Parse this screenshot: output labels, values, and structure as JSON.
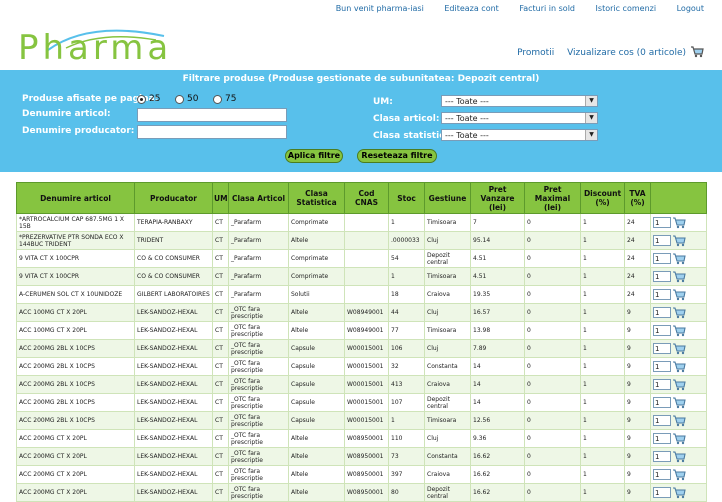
{
  "topnav": {
    "welcome": "Bun venit pharma-iasi",
    "edit_account": "Editeaza cont",
    "invoices": "Facturi in sold",
    "order_history": "Istoric comenzi",
    "logout": "Logout"
  },
  "logo": {
    "text": "Pharma"
  },
  "promo": {
    "promotions": "Promotii",
    "view_cart": "Vizualizare cos (0 articole)"
  },
  "filter": {
    "title_prefix": "Filtrare produse (Produse gestionate de subunitatea: ",
    "unit": "Depozit central",
    "title_suffix": ")",
    "per_page_label": "Produse afisate pe pagina:",
    "per_page_options": [
      "25",
      "50",
      "75"
    ],
    "per_page_selected": "25",
    "article_label": "Denumire articol:",
    "article_value": "",
    "producer_label": "Denumire producator:",
    "producer_value": "",
    "um_label": "UM:",
    "um_value": "--- Toate ---",
    "class_article_label": "Clasa articol:",
    "class_article_value": "--- Toate ---",
    "class_stat_label": "Clasa statistica:",
    "class_stat_value": "--- Toate ---",
    "apply_button": "Aplica filtre",
    "reset_button": "Reseteaza filtre"
  },
  "table": {
    "headers": {
      "name": "Denumire articol",
      "producer": "Producator",
      "um": "UM",
      "class_article": "Clasa Articol",
      "class_stat": "Clasa Statistica",
      "cnas": "Cod CNAS",
      "stock": "Stoc",
      "depot": "Gestiune",
      "price_sell": "Pret Vanzare (lei)",
      "price_max": "Pret Maximal (lei)",
      "discount": "Discount (%)",
      "vat": "TVA (%)"
    },
    "rows": [
      {
        "name": "*ARTROCALCIUM CAP 687.5MG 1 X 15B",
        "producer": "TERAPIA-RANBAXY",
        "um": "CT",
        "class_article": "_Parafarm",
        "class_stat": "Comprimate",
        "cnas": "",
        "stock": "1",
        "depot": "Timisoara",
        "price_sell": "7",
        "price_max": "0",
        "discount": "1",
        "vat": "24",
        "qty": "1"
      },
      {
        "name": "*PREZERVATIVE PTR SONDA ECO X 144BUC TRIDENT",
        "producer": "TRIDENT",
        "um": "CT",
        "class_article": "_Parafarm",
        "class_stat": "Altele",
        "cnas": "",
        "stock": ".0000033",
        "depot": "Cluj",
        "price_sell": "95.14",
        "price_max": "0",
        "discount": "1",
        "vat": "24",
        "qty": "1"
      },
      {
        "name": "9 VITA CT X 100CPR",
        "producer": "CO & CO CONSUMER",
        "um": "CT",
        "class_article": "_Parafarm",
        "class_stat": "Comprimate",
        "cnas": "",
        "stock": "54",
        "depot": "Depozit central",
        "price_sell": "4.51",
        "price_max": "0",
        "discount": "1",
        "vat": "24",
        "qty": "1"
      },
      {
        "name": "9 VITA CT X 100CPR",
        "producer": "CO & CO CONSUMER",
        "um": "CT",
        "class_article": "_Parafarm",
        "class_stat": "Comprimate",
        "cnas": "",
        "stock": "1",
        "depot": "Timisoara",
        "price_sell": "4.51",
        "price_max": "0",
        "discount": "1",
        "vat": "24",
        "qty": "1"
      },
      {
        "name": "A-CERUMEN SOL CT X 10UNIDOZE",
        "producer": "GILBERT LABORATOIRES",
        "um": "CT",
        "class_article": "_Parafarm",
        "class_stat": "Solutii",
        "cnas": "",
        "stock": "18",
        "depot": "Craiova",
        "price_sell": "19.35",
        "price_max": "0",
        "discount": "1",
        "vat": "24",
        "qty": "1"
      },
      {
        "name": "ACC 100MG CT X 20PL",
        "producer": "LEK-SANDOZ-HEXAL",
        "um": "CT",
        "class_article": "_OTC fara prescriptie",
        "class_stat": "Altele",
        "cnas": "W08949001",
        "stock": "44",
        "depot": "Cluj",
        "price_sell": "16.57",
        "price_max": "0",
        "discount": "1",
        "vat": "9",
        "qty": "1"
      },
      {
        "name": "ACC 100MG CT X 20PL",
        "producer": "LEK-SANDOZ-HEXAL",
        "um": "CT",
        "class_article": "_OTC fara prescriptie",
        "class_stat": "Altele",
        "cnas": "W08949001",
        "stock": "77",
        "depot": "Timisoara",
        "price_sell": "13.98",
        "price_max": "0",
        "discount": "1",
        "vat": "9",
        "qty": "1"
      },
      {
        "name": "ACC 200MG 2BL X 10CPS",
        "producer": "LEK-SANDOZ-HEXAL",
        "um": "CT",
        "class_article": "_OTC fara prescriptie",
        "class_stat": "Capsule",
        "cnas": "W00015001",
        "stock": "106",
        "depot": "Cluj",
        "price_sell": "7.89",
        "price_max": "0",
        "discount": "1",
        "vat": "9",
        "qty": "1"
      },
      {
        "name": "ACC 200MG 2BL X 10CPS",
        "producer": "LEK-SANDOZ-HEXAL",
        "um": "CT",
        "class_article": "_OTC fara prescriptie",
        "class_stat": "Capsule",
        "cnas": "W00015001",
        "stock": "32",
        "depot": "Constanta",
        "price_sell": "14",
        "price_max": "0",
        "discount": "1",
        "vat": "9",
        "qty": "1"
      },
      {
        "name": "ACC 200MG 2BL X 10CPS",
        "producer": "LEK-SANDOZ-HEXAL",
        "um": "CT",
        "class_article": "_OTC fara prescriptie",
        "class_stat": "Capsule",
        "cnas": "W00015001",
        "stock": "413",
        "depot": "Craiova",
        "price_sell": "14",
        "price_max": "0",
        "discount": "1",
        "vat": "9",
        "qty": "1"
      },
      {
        "name": "ACC 200MG 2BL X 10CPS",
        "producer": "LEK-SANDOZ-HEXAL",
        "um": "CT",
        "class_article": "_OTC fara prescriptie",
        "class_stat": "Capsule",
        "cnas": "W00015001",
        "stock": "107",
        "depot": "Depozit central",
        "price_sell": "14",
        "price_max": "0",
        "discount": "1",
        "vat": "9",
        "qty": "1"
      },
      {
        "name": "ACC 200MG 2BL X 10CPS",
        "producer": "LEK-SANDOZ-HEXAL",
        "um": "CT",
        "class_article": "_OTC fara prescriptie",
        "class_stat": "Capsule",
        "cnas": "W00015001",
        "stock": "1",
        "depot": "Timisoara",
        "price_sell": "12.56",
        "price_max": "0",
        "discount": "1",
        "vat": "9",
        "qty": "1"
      },
      {
        "name": "ACC 200MG CT X 20PL",
        "producer": "LEK-SANDOZ-HEXAL",
        "um": "CT",
        "class_article": "_OTC fara prescriptie",
        "class_stat": "Altele",
        "cnas": "W08950001",
        "stock": "110",
        "depot": "Cluj",
        "price_sell": "9.36",
        "price_max": "0",
        "discount": "1",
        "vat": "9",
        "qty": "1"
      },
      {
        "name": "ACC 200MG CT X 20PL",
        "producer": "LEK-SANDOZ-HEXAL",
        "um": "CT",
        "class_article": "_OTC fara prescriptie",
        "class_stat": "Altele",
        "cnas": "W08950001",
        "stock": "73",
        "depot": "Constanta",
        "price_sell": "16.62",
        "price_max": "0",
        "discount": "1",
        "vat": "9",
        "qty": "1"
      },
      {
        "name": "ACC 200MG CT X 20PL",
        "producer": "LEK-SANDOZ-HEXAL",
        "um": "CT",
        "class_article": "_OTC fara prescriptie",
        "class_stat": "Altele",
        "cnas": "W08950001",
        "stock": "397",
        "depot": "Craiova",
        "price_sell": "16.62",
        "price_max": "0",
        "discount": "1",
        "vat": "9",
        "qty": "1"
      },
      {
        "name": "ACC 200MG CT X 20PL",
        "producer": "LEK-SANDOZ-HEXAL",
        "um": "CT",
        "class_article": "_OTC fara prescriptie",
        "class_stat": "Altele",
        "cnas": "W08950001",
        "stock": "80",
        "depot": "Depozit central",
        "price_sell": "16.62",
        "price_max": "0",
        "discount": "1",
        "vat": "9",
        "qty": "1"
      }
    ]
  },
  "colors": {
    "brand_green": "#86c440",
    "filter_blue": "#58c0eb",
    "link_blue": "#1f6aa5"
  },
  "icons": {
    "cart": "cart-icon",
    "add_to_cart": "add-to-cart-icon"
  }
}
